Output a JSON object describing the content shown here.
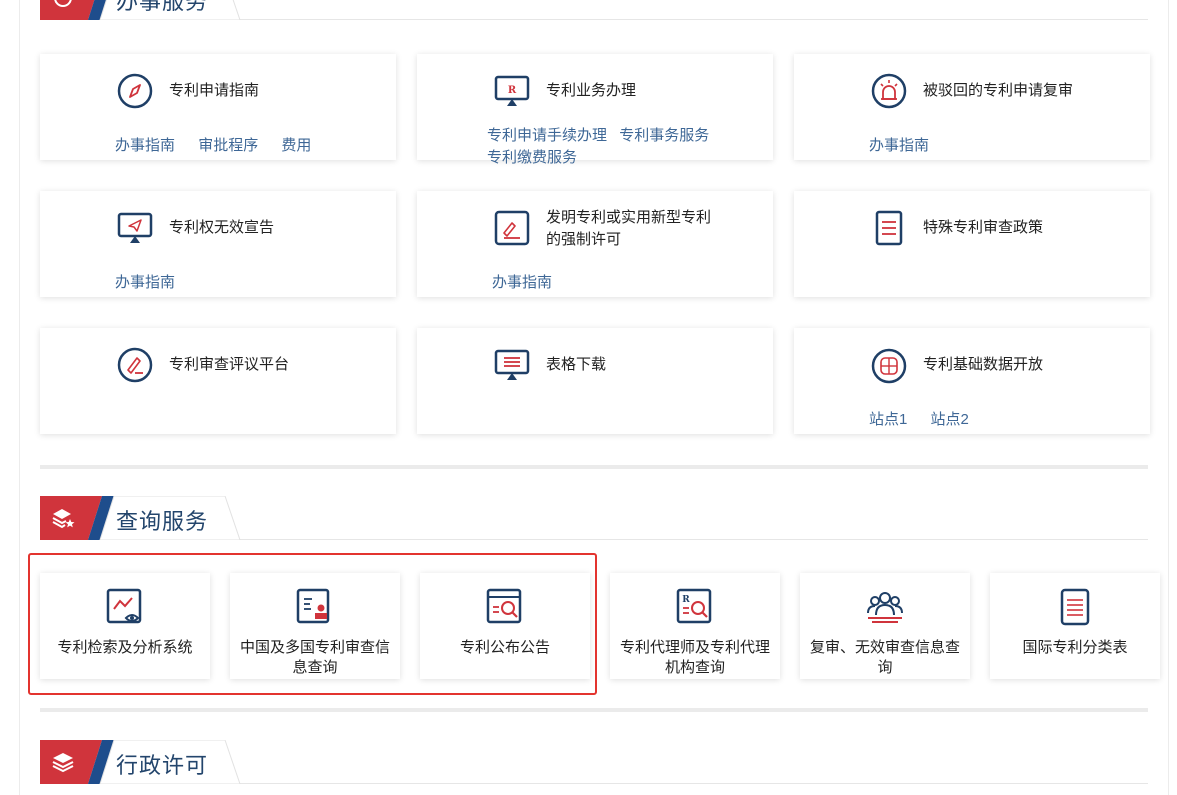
{
  "sections": {
    "services": {
      "title": "办事服务"
    },
    "query": {
      "title": "查询服务"
    },
    "admin": {
      "title": "行政许可"
    }
  },
  "service_cards": [
    {
      "title": "专利申请指南",
      "links": [
        "办事指南",
        "审批程序",
        "费用"
      ],
      "icon": "compass-icon"
    },
    {
      "title": "专利业务办理",
      "links": [
        "专利申请手续办理",
        "专利事务服务",
        "专利缴费服务"
      ],
      "icon": "monitor-r-icon"
    },
    {
      "title": "被驳回的专利申请复审",
      "links": [
        "办事指南"
      ],
      "icon": "alarm-light-icon"
    },
    {
      "title": "专利权无效宣告",
      "links": [
        "办事指南"
      ],
      "icon": "monitor-plane-icon"
    },
    {
      "title_line1": "发明专利或实用新型专利",
      "title_line2": "的强制许可",
      "links": [
        "办事指南"
      ],
      "icon": "edit-doc-icon"
    },
    {
      "title": "特殊专利审查政策",
      "links": [],
      "icon": "document-icon"
    },
    {
      "title": "专利审查评议平台",
      "links": [],
      "icon": "pen-circle-icon"
    },
    {
      "title": "表格下载",
      "links": [],
      "icon": "monitor-list-icon"
    },
    {
      "title": "专利基础数据开放",
      "links": [
        "站点1",
        "站点2"
      ],
      "icon": "database-globe-icon"
    }
  ],
  "query_cards": [
    {
      "label": "专利检索及分析系统",
      "icon": "chart-search-icon"
    },
    {
      "label": "中国及多国专利审查信息查询",
      "icon": "doc-stamp-icon"
    },
    {
      "label": "专利公布公告",
      "icon": "doc-magnifier-icon"
    },
    {
      "label": "专利代理师及专利代理机构查询",
      "icon": "r-magnifier-icon"
    },
    {
      "label": "复审、无效审查信息查询",
      "icon": "people-group-icon"
    },
    {
      "label": "国际专利分类表",
      "icon": "notebook-icon"
    }
  ],
  "colors": {
    "navy": "#1f3f66",
    "red": "#d0343c",
    "link": "#3e6796",
    "highlight": "#e3342f"
  }
}
